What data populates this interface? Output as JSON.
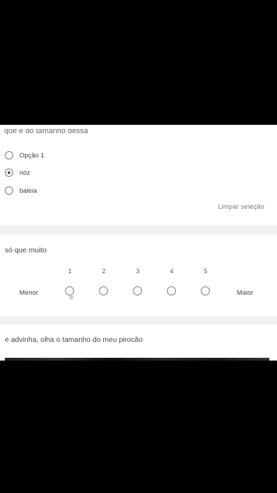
{
  "q1": {
    "title_partial": "que é do tamanho dessa",
    "options": [
      {
        "label": "Opção 1",
        "checked": false
      },
      {
        "label": "nóz",
        "checked": true
      },
      {
        "label": "baleia",
        "checked": false
      }
    ],
    "clear_label": "Limpar seleção"
  },
  "q2": {
    "title": "só que muito",
    "scale": [
      "1",
      "2",
      "3",
      "4",
      "5"
    ],
    "min_label": "Menor",
    "max_label": "Maior"
  },
  "q3": {
    "title": "e advinha, olha o tamanho do meu pirocão"
  }
}
